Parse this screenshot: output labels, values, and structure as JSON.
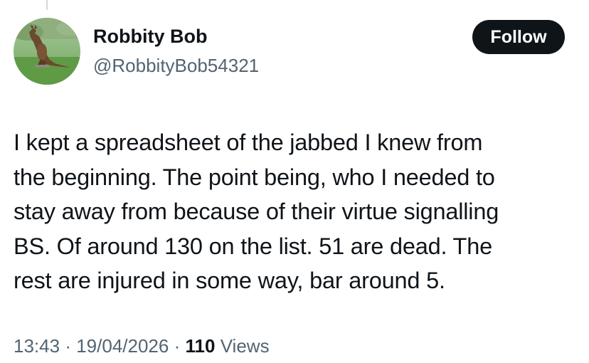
{
  "user": {
    "display_name": "Robbity Bob",
    "handle": "@RobbityBob54321",
    "avatar_icon": "kangaroo-statue-photo"
  },
  "follow_button": {
    "label": "Follow"
  },
  "tweet": {
    "lines": [
      "I kept a spreadsheet of the jabbed I knew from",
      "the beginning. The point being, who I needed to",
      "stay away from because of their virtue signalling",
      "BS. Of around 130 on the list. 51 are dead. The",
      "rest are injured in some way, bar around 5."
    ]
  },
  "meta": {
    "time": "13:43",
    "separator": "·",
    "date": "19/04/2026",
    "views_count": "110",
    "views_label": "Views"
  },
  "colors": {
    "text_primary": "#0f1419",
    "text_secondary": "#536471",
    "button_bg": "#0f1419",
    "button_text": "#ffffff"
  }
}
